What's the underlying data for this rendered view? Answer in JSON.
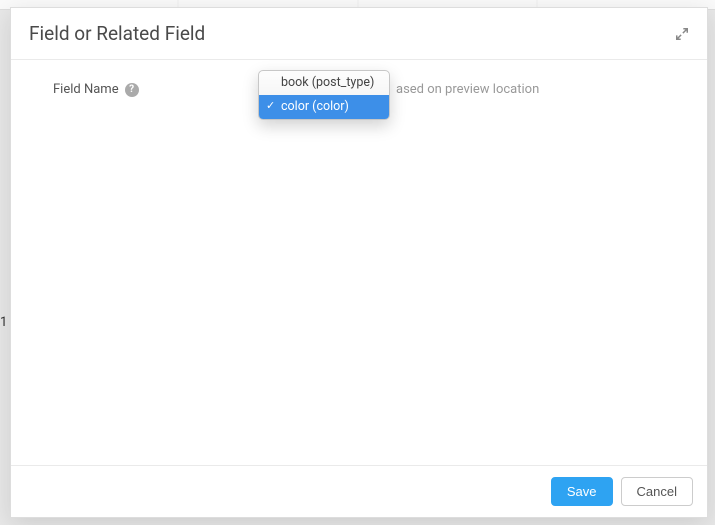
{
  "header": {
    "title": "Field or Related Field"
  },
  "form": {
    "field_name_label": "Field Name",
    "hint_suffix": "ased on preview location"
  },
  "dropdown": {
    "items": [
      {
        "label": "book (post_type)",
        "selected": false
      },
      {
        "label": "color (color)",
        "selected": true
      }
    ]
  },
  "footer": {
    "save_label": "Save",
    "cancel_label": "Cancel"
  },
  "bg": {
    "row_marker": "1"
  }
}
